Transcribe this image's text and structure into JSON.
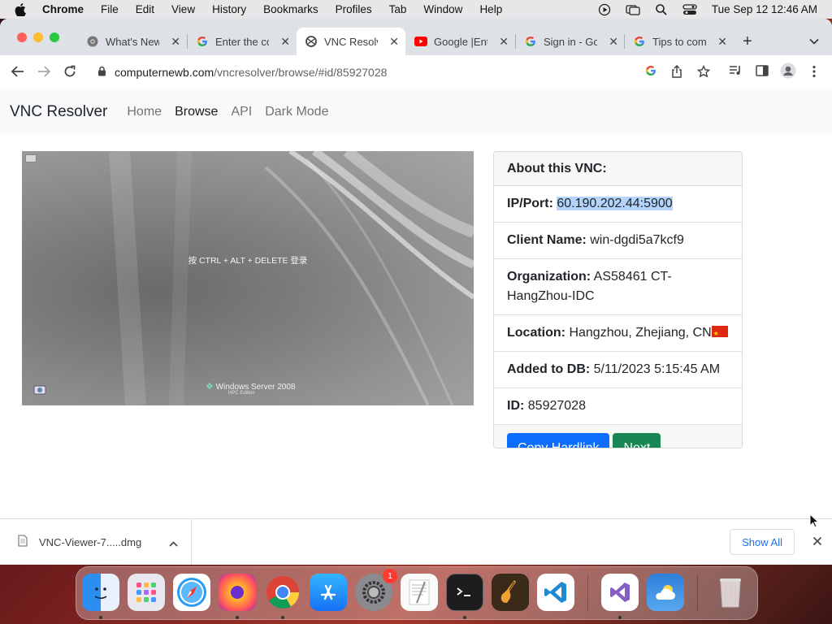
{
  "menubar": {
    "app": "Chrome",
    "items": [
      "File",
      "Edit",
      "View",
      "History",
      "Bookmarks",
      "Profiles",
      "Tab",
      "Window",
      "Help"
    ],
    "clock": "Tue Sep 12  12:46 AM"
  },
  "tabs": [
    {
      "title": "What's New",
      "icon": "chrome-icon"
    },
    {
      "title": "Enter the co",
      "icon": "google-icon"
    },
    {
      "title": "VNC Resolve",
      "icon": "vnc-resolver-icon",
      "active": true
    },
    {
      "title": "Google |Ente",
      "icon": "youtube-icon"
    },
    {
      "title": "Sign in - Go",
      "icon": "google-icon"
    },
    {
      "title": "Tips to comp",
      "icon": "google-icon"
    }
  ],
  "address": {
    "host": "computernewb.com",
    "path": "/vncresolver/browse/#id/85927028"
  },
  "navbar": {
    "brand": "VNC Resolver",
    "links": [
      "Home",
      "Browse",
      "API",
      "Dark Mode"
    ],
    "active": "Browse"
  },
  "screenshot": {
    "login_text": "按 CTRL + ALT + DELETE 登录",
    "logo_text": "Windows Server 2008",
    "edition_text": "HPC Edition"
  },
  "card": {
    "header": "About this VNC:",
    "ip_label": "IP/Port:",
    "ip_value": "60.190.202.44:5900",
    "client_label": "Client Name:",
    "client_value": "win-dgdi5a7kcf9",
    "org_label": "Organization:",
    "org_value": "AS58461 CT-HangZhou-IDC",
    "location_label": "Location:",
    "location_value": "Hangzhou, Zhejiang, CN",
    "added_label": "Added to DB:",
    "added_value": "5/11/2023 5:15:45 AM",
    "id_label": "ID:",
    "id_value": "85927028",
    "copy_button": "Copy Hardlink",
    "next_button": "Next"
  },
  "downloads": {
    "file": "VNC-Viewer-7.....dmg",
    "show_all": "Show All"
  },
  "dock": {
    "apps": [
      "Finder",
      "Launchpad",
      "Safari",
      "Firefox",
      "Chrome",
      "App Store",
      "System Preferences",
      "TextEdit",
      "Terminal",
      "GarageBand",
      "Visual Studio Code",
      "Visual Studio",
      "Weather",
      "Trash"
    ],
    "settings_badge": "1"
  },
  "colors": {
    "primary": "#0d6efd",
    "success": "#198754",
    "selection": "#b3d4fc"
  }
}
